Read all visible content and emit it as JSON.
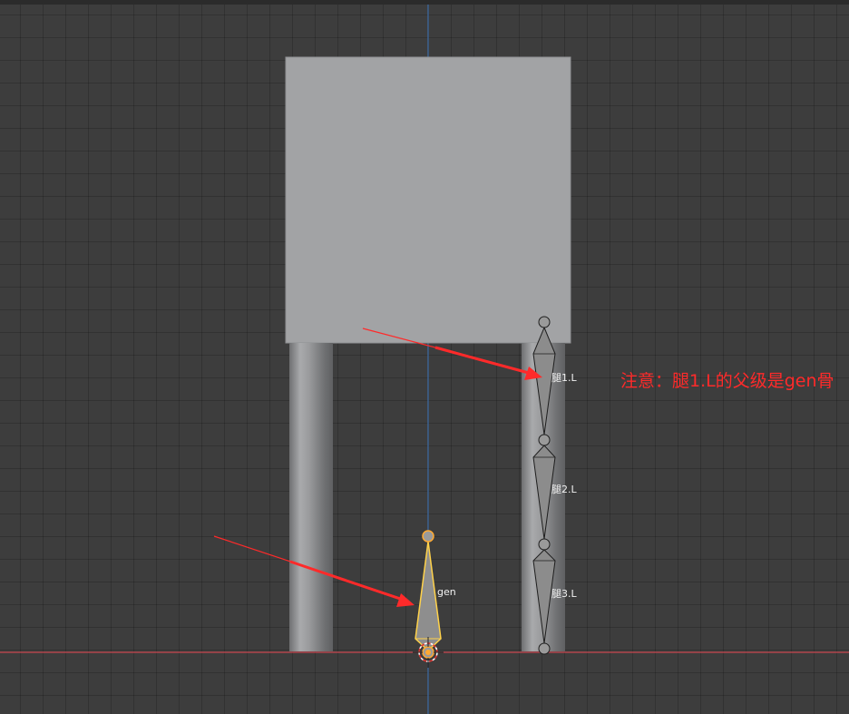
{
  "scene": {
    "bones": [
      {
        "id": "gen",
        "label": "gen",
        "selected": true
      },
      {
        "id": "leg1",
        "label": "腿1.L",
        "selected": false
      },
      {
        "id": "leg2",
        "label": "腿2.L",
        "selected": false
      },
      {
        "id": "leg3",
        "label": "腿3.L",
        "selected": false
      }
    ]
  },
  "annotation": {
    "text": "注意：腿1.L的父级是gen骨",
    "color": "#ff2a2a"
  },
  "colors": {
    "background": "#3d3d3d",
    "mesh": "#a2a3a5",
    "bone_fill": "#8c8c8c",
    "bone_selected_outline": "#ffd24a",
    "x_axis": "#c8454f",
    "z_axis": "#3f6ea8",
    "arrow": "#ff2a2a"
  },
  "icons": {
    "origin": "3d-cursor-icon"
  }
}
